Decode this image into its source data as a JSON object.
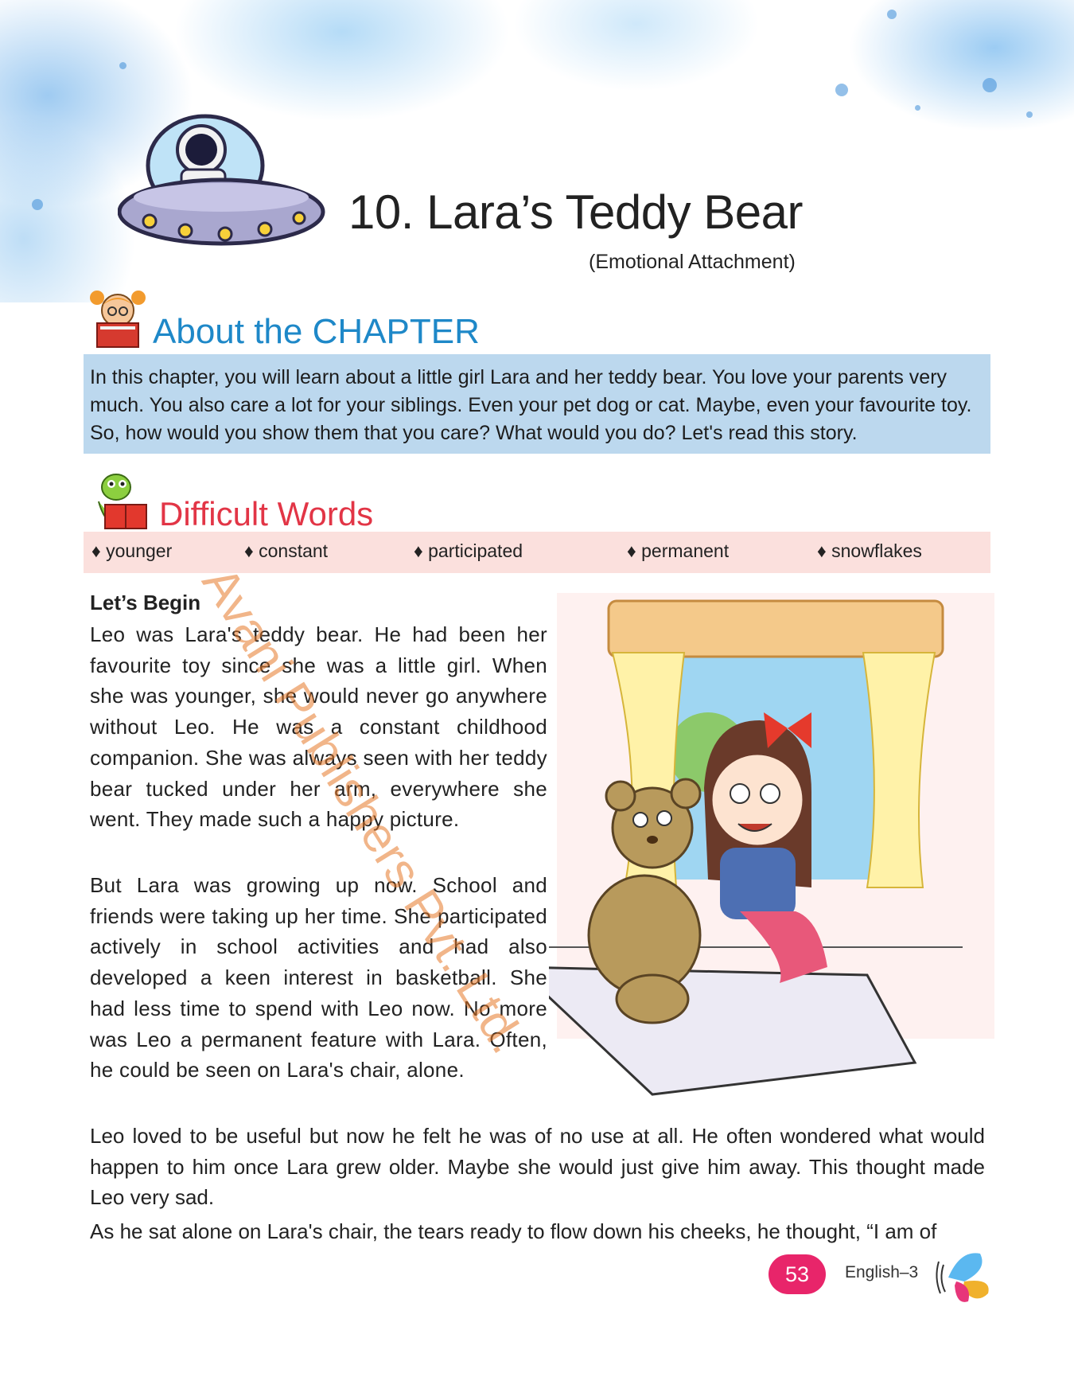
{
  "chapter": {
    "title": "10. Lara’s Teddy Bear",
    "subtitle": "(Emotional Attachment)"
  },
  "about": {
    "heading": "About the CHAPTER",
    "text": "In this chapter, you will learn about a little girl Lara and her teddy bear. You love your parents very much. You also care a lot for your siblings. Even your pet dog or cat. Maybe, even your favourite toy. So, how would you show them that you care? What would you do? Let's read this story."
  },
  "difficult_words": {
    "heading": "Difficult Words",
    "words": [
      "♦ younger",
      "♦ constant",
      "♦ participated",
      "♦ permanent",
      "♦ snowflakes"
    ]
  },
  "story": {
    "heading": "Let’s Begin",
    "paragraphs": [
      "Leo was Lara's teddy bear. He had been her favourite toy since she was a little girl. When she was younger, she would never go anywhere without Leo. He was a constant childhood companion. She was always seen with her teddy bear tucked under her arm, everywhere she went. They made such a happy picture.",
      "But Lara was growing up now. School and friends were taking up her time. She participated actively in school activities and had also developed a keen interest in basketball. She had less time to spend with Leo now. No more was Leo a permanent feature with Lara. Often, he could be seen on Lara's chair, alone.",
      "Leo loved to be useful but now he felt he was of no use at all. He often wondered what would happen to him once Lara grew older. Maybe she would just give him away. This thought made Leo very sad.",
      "As he sat alone on Lara's chair, the tears ready to flow down his cheeks, he thought, “I am of"
    ]
  },
  "watermark": "Avani Publishers Pvt. Ltd.",
  "footer": {
    "page_number": "53",
    "book": "English–3"
  },
  "colors": {
    "about_heading": "#1e88c8",
    "about_box": "#bcd8ee",
    "dw_heading": "#e23546",
    "dw_strip": "#fbe0dd",
    "page_badge": "#e8256a"
  }
}
